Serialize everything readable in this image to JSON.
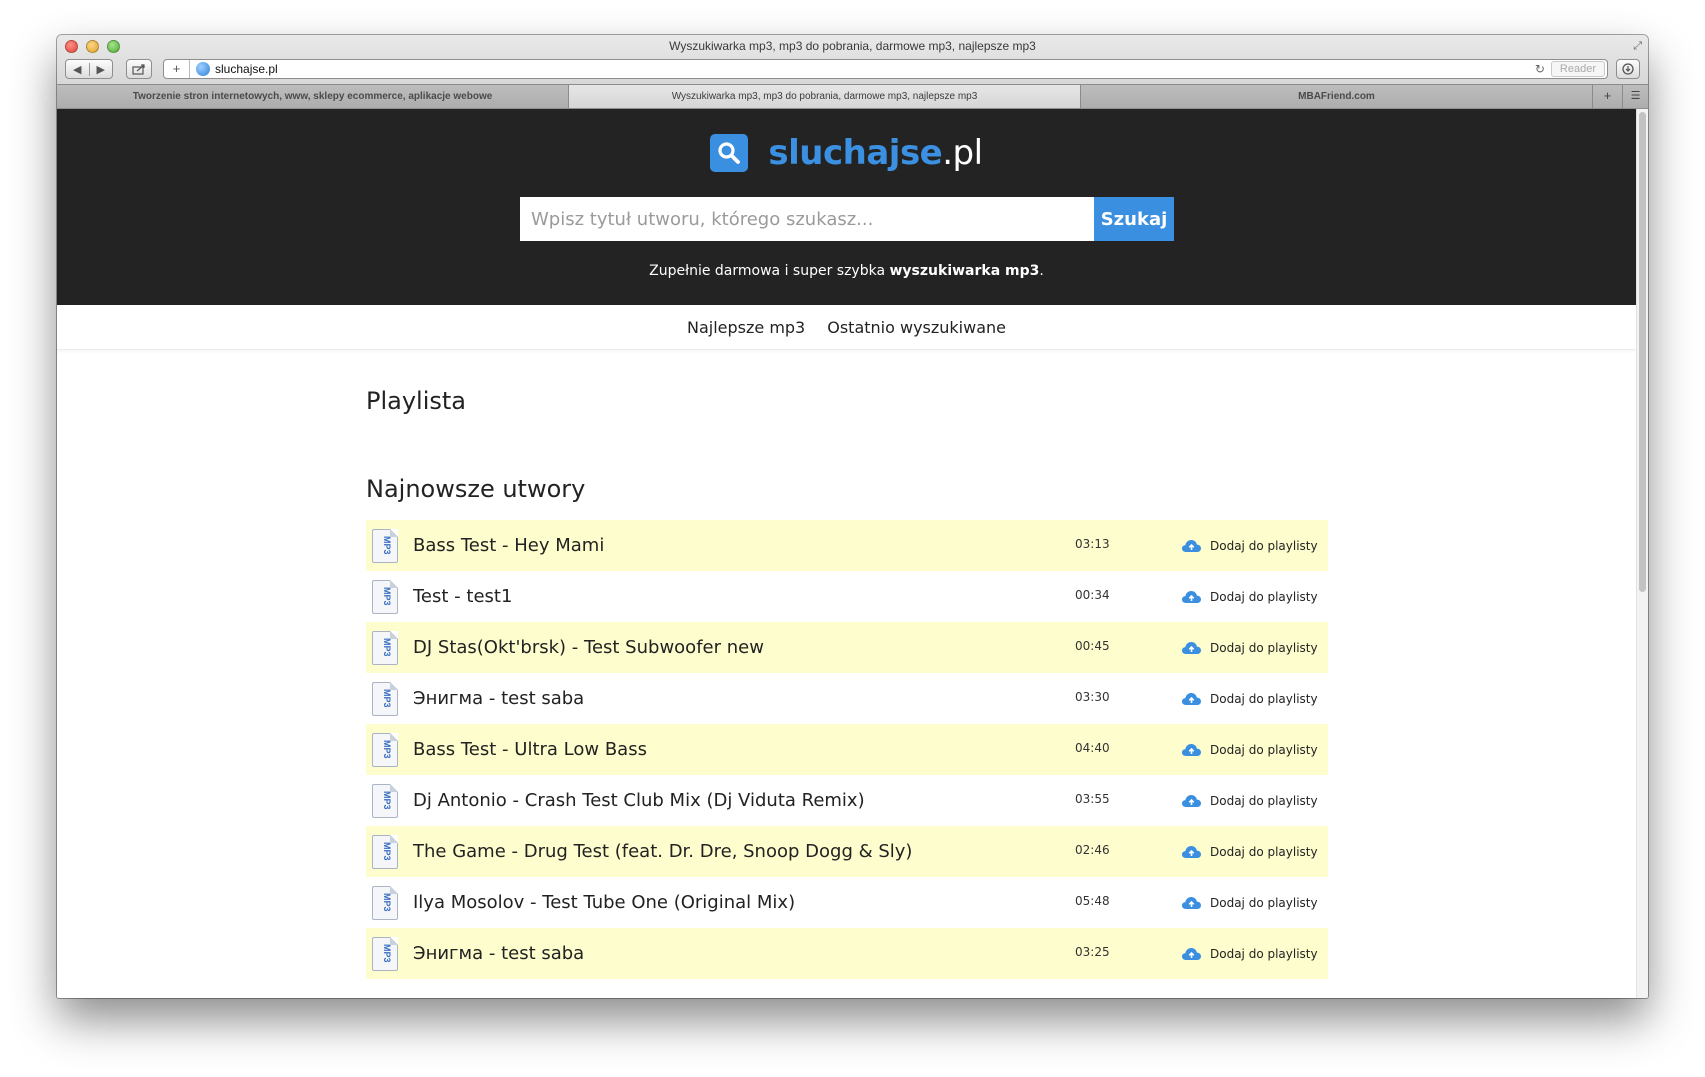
{
  "window": {
    "title": "Wyszukiwarka mp3, mp3 do pobrania, darmowe mp3, najlepsze mp3",
    "url": "sluchajse.pl",
    "reader_label": "Reader"
  },
  "tabs": [
    {
      "label": "Tworzenie stron internetowych, www, sklepy ecommerce, aplikacje webowe",
      "active": false
    },
    {
      "label": "Wyszukiwarka mp3, mp3 do pobrania, darmowe mp3, najlepsze mp3",
      "active": true
    },
    {
      "label": "MBAFriend.com",
      "active": false
    }
  ],
  "site": {
    "brand": "sluchajse",
    "tld": ".pl",
    "accent_color": "#3b8fe0",
    "search": {
      "placeholder": "Wpisz tytuł utworu, którego szukasz...",
      "value": "",
      "button_label": "Szukaj"
    },
    "tagline_prefix": "Zupełnie darmowa i super szybka ",
    "tagline_bold": "wyszukiwarka mp3",
    "tagline_suffix": "."
  },
  "nav": {
    "items": [
      "Najlepsze mp3",
      "Ostatnio wyszukiwane"
    ]
  },
  "sections": {
    "playlist_heading": "Playlista",
    "latest_heading": "Najnowsze utwory"
  },
  "tracks": [
    {
      "artist": "Bass Test",
      "title": "Hey Mami",
      "time": "03:13"
    },
    {
      "artist": "Test",
      "title": "test1",
      "time": "00:34"
    },
    {
      "artist": "DJ Stas(Okt'brsk)",
      "title": "Test Subwoofer new",
      "time": "00:45"
    },
    {
      "artist": "Энигма",
      "title": "test saba",
      "time": "03:30"
    },
    {
      "artist": "Bass Test",
      "title": "Ultra Low Bass",
      "time": "04:40"
    },
    {
      "artist": "Dj Antonio",
      "title": "Crash Test Club Mix (Dj Viduta Remix)",
      "time": "03:55"
    },
    {
      "artist": "The Game",
      "title": "Drug Test (feat. Dr. Dre, Snoop Dogg & Sly)",
      "time": "02:46"
    },
    {
      "artist": "Ilya Mosolov",
      "title": "Test Tube One (Original Mix)",
      "time": "05:48"
    },
    {
      "artist": "Энигма",
      "title": "test saba",
      "time": "03:25"
    }
  ],
  "track_add_label": "Dodaj do playlisty",
  "track_file_label": "MP3",
  "icons": {
    "logo": "search-icon",
    "track_file": "mp3-file-icon",
    "add": "cloud-upload-icon"
  },
  "colors": {
    "hero_bg": "#232323",
    "row_highlight": "#fefdcd"
  }
}
